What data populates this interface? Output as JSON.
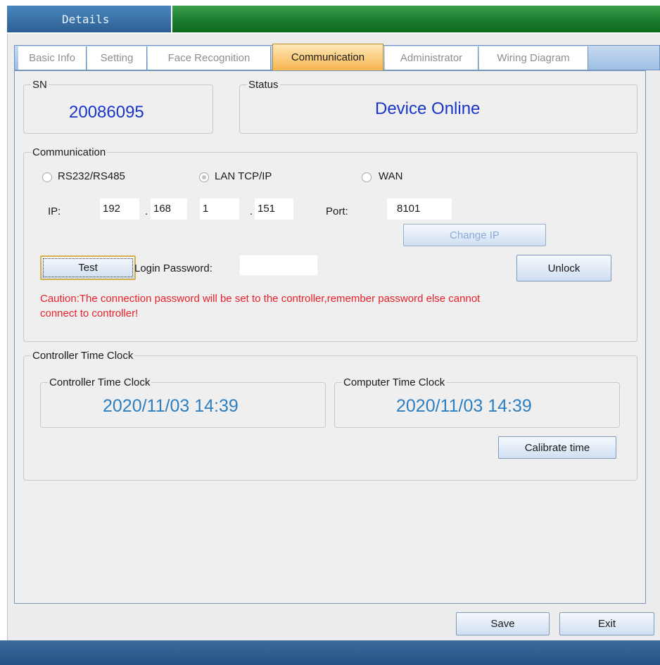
{
  "window": {
    "title": "Details"
  },
  "tabs": [
    {
      "label": "Basic Info",
      "active": false
    },
    {
      "label": "Setting",
      "active": false
    },
    {
      "label": "Face Recognition",
      "active": false
    },
    {
      "label": "Communication",
      "active": true
    },
    {
      "label": "Administrator",
      "active": false
    },
    {
      "label": "Wiring Diagram",
      "active": false
    }
  ],
  "sn": {
    "legend": "SN",
    "value": "20086095"
  },
  "status": {
    "legend": "Status",
    "value": "Device Online"
  },
  "communication": {
    "legend": "Communication",
    "modes": [
      {
        "label": "RS232/RS485",
        "checked": false
      },
      {
        "label": "LAN TCP/IP",
        "checked": true
      },
      {
        "label": "WAN",
        "checked": false
      }
    ],
    "ip_label": "IP:",
    "ip_octets": [
      "192",
      "168",
      "1",
      "151"
    ],
    "ip_separator": ".",
    "port_label": "Port:",
    "port_value": "8101",
    "change_ip_label": "Change IP",
    "test_label": "Test",
    "login_password_label": "Login Password:",
    "login_password_value": "",
    "unlock_label": "Unlock",
    "caution_line1": "Caution:The connection password will be set to the controller,remember password else cannot",
    "caution_line2": "connect to controller!"
  },
  "clock": {
    "legend": "Controller Time Clock",
    "controller_legend": "Controller Time Clock",
    "controller_value": "2020/11/03 14:39",
    "computer_legend": "Computer Time Clock",
    "computer_value": "2020/11/03 14:39",
    "calibrate_label": "Calibrate time"
  },
  "footer": {
    "save_label": "Save",
    "exit_label": "Exit"
  },
  "colors": {
    "accent_blue": "#1a35c9",
    "clock_blue": "#2d7fc1",
    "caution_red": "#e8202a",
    "title_green": "#1a7a2b",
    "active_tab_orange": "#f6b54e"
  }
}
